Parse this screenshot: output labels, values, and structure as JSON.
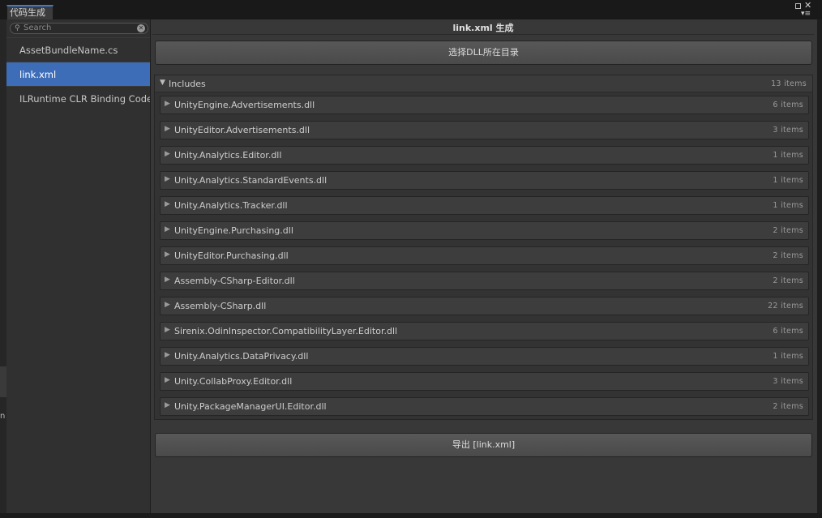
{
  "window": {
    "tab_title": "代码生成"
  },
  "sidebar": {
    "search_placeholder": "Search",
    "items": [
      {
        "label": "AssetBundleName.cs",
        "selected": false
      },
      {
        "label": "link.xml",
        "selected": true
      },
      {
        "label": "ILRuntime CLR Binding Code",
        "selected": false
      }
    ]
  },
  "main": {
    "title": "link.xml 生成",
    "select_button": "选择DLL所在目录",
    "export_button": "导出 [link.xml]",
    "includes": {
      "label": "Includes",
      "count": "13 items",
      "assemblies": [
        {
          "name": "UnityEngine.Advertisements.dll",
          "count": "6 items"
        },
        {
          "name": "UnityEditor.Advertisements.dll",
          "count": "3 items"
        },
        {
          "name": "Unity.Analytics.Editor.dll",
          "count": "1 items"
        },
        {
          "name": "Unity.Analytics.StandardEvents.dll",
          "count": "1 items"
        },
        {
          "name": "Unity.Analytics.Tracker.dll",
          "count": "1 items"
        },
        {
          "name": "UnityEngine.Purchasing.dll",
          "count": "2 items"
        },
        {
          "name": "UnityEditor.Purchasing.dll",
          "count": "2 items"
        },
        {
          "name": "Assembly-CSharp-Editor.dll",
          "count": "2 items"
        },
        {
          "name": "Assembly-CSharp.dll",
          "count": "22 items"
        },
        {
          "name": "Sirenix.OdinInspector.CompatibilityLayer.Editor.dll",
          "count": "6 items"
        },
        {
          "name": "Unity.Analytics.DataPrivacy.dll",
          "count": "1 items"
        },
        {
          "name": "Unity.CollabProxy.Editor.dll",
          "count": "3 items"
        },
        {
          "name": "Unity.PackageManagerUI.Editor.dll",
          "count": "2 items"
        }
      ]
    }
  },
  "colors": {
    "selection": "#3e6db8",
    "window_bg": "#383838",
    "tab_accent": "#3d7bd1"
  },
  "icons": {
    "collapse_arrow": "triangle-right",
    "expand_arrow": "triangle-down",
    "search": "magnifier",
    "clear": "x-circle"
  }
}
